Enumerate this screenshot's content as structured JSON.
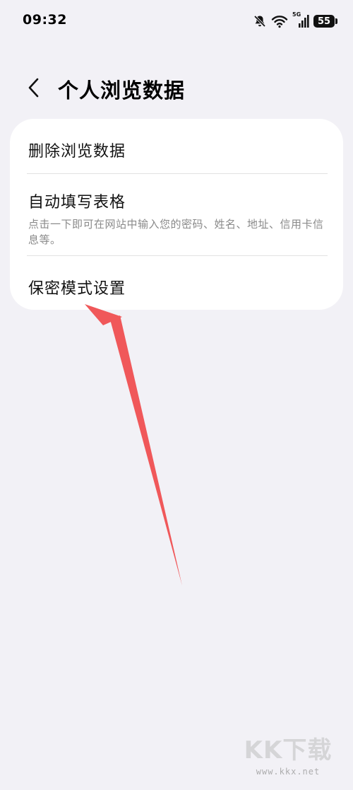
{
  "status_bar": {
    "time": "09:32",
    "network_label": "5G",
    "battery_level": "55",
    "icons": [
      "mute-bell-icon",
      "wifi-icon",
      "cellular-signal-icon",
      "battery-icon"
    ]
  },
  "header": {
    "back_icon": "chevron-left-icon",
    "title": "个人浏览数据"
  },
  "settings": {
    "items": [
      {
        "label": "删除浏览数据",
        "description": ""
      },
      {
        "label": "自动填写表格",
        "description": "点击一下即可在网站中输入您的密码、姓名、地址、信用卡信息等。"
      },
      {
        "label": "保密模式设置",
        "description": ""
      }
    ]
  },
  "annotation": {
    "type": "arrow",
    "color": "#f0585a",
    "points_to": "保密模式设置"
  },
  "watermark": {
    "logo_text": "KK下载",
    "url": "www.kkx.net"
  },
  "colors": {
    "background": "#f2f1f6",
    "card": "#ffffff",
    "subtitle": "#8a8a8a",
    "arrow": "#f0585a"
  }
}
